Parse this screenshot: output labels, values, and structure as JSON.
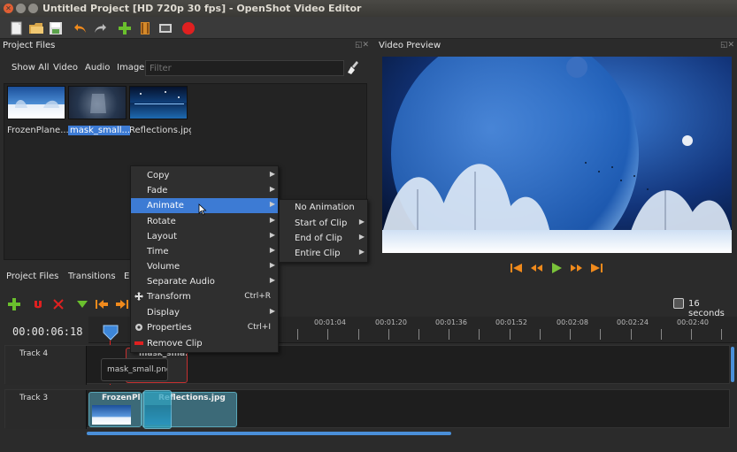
{
  "window": {
    "title": "Untitled Project [HD 720p 30 fps] - OpenShot Video Editor"
  },
  "project_files": {
    "title": "Project Files",
    "filters": [
      "Show All",
      "Video",
      "Audio",
      "Image"
    ],
    "filter_placeholder": "Filter",
    "files": [
      {
        "label": "FrozenPlane...",
        "selected": false
      },
      {
        "label": "mask_small....",
        "selected": true
      },
      {
        "label": "Reflections.jpg",
        "selected": false
      }
    ]
  },
  "video_preview": {
    "title": "Video Preview"
  },
  "lower_tabs": [
    "Project Files",
    "Transitions",
    "E"
  ],
  "timeline": {
    "timecode": "00:00:06:18",
    "zoom": "16 seconds",
    "ruler_labels": [
      "00:01:04",
      "00:01:20",
      "00:01:36",
      "00:01:52",
      "00:02:08",
      "00:02:24",
      "00:02:40"
    ],
    "tracks": [
      {
        "name": "Track 4",
        "clips": [
          "mask_sma...",
          "mask_small.png"
        ]
      },
      {
        "name": "Track 3",
        "clips": [
          "FrozenPla...",
          "Reflections.jpg"
        ]
      }
    ]
  },
  "context_menu": {
    "items": [
      {
        "label": "Copy",
        "submenu": true
      },
      {
        "label": "Fade",
        "submenu": true
      },
      {
        "label": "Animate",
        "submenu": true,
        "active": true
      },
      {
        "label": "Rotate",
        "submenu": true
      },
      {
        "label": "Layout",
        "submenu": true
      },
      {
        "label": "Time",
        "submenu": true
      },
      {
        "label": "Volume",
        "submenu": true
      },
      {
        "label": "Separate Audio",
        "submenu": true
      },
      {
        "label": "Transform",
        "shortcut": "Ctrl+R",
        "icon": "move-icon"
      },
      {
        "label": "Display",
        "submenu": true
      },
      {
        "label": "Properties",
        "shortcut": "Ctrl+I",
        "icon": "gear-icon"
      },
      {
        "label": "Remove Clip",
        "icon": "remove-icon"
      }
    ]
  },
  "animate_submenu": {
    "items": [
      {
        "label": "No Animation",
        "submenu": false
      },
      {
        "label": "Start of Clip",
        "submenu": true
      },
      {
        "label": "End of Clip",
        "submenu": true
      },
      {
        "label": "Entire Clip",
        "submenu": true
      }
    ]
  },
  "colors": {
    "accent": "#3d7bd4",
    "record": "#e02020",
    "play": "#7ac33a",
    "transport": "#f08a1c"
  }
}
